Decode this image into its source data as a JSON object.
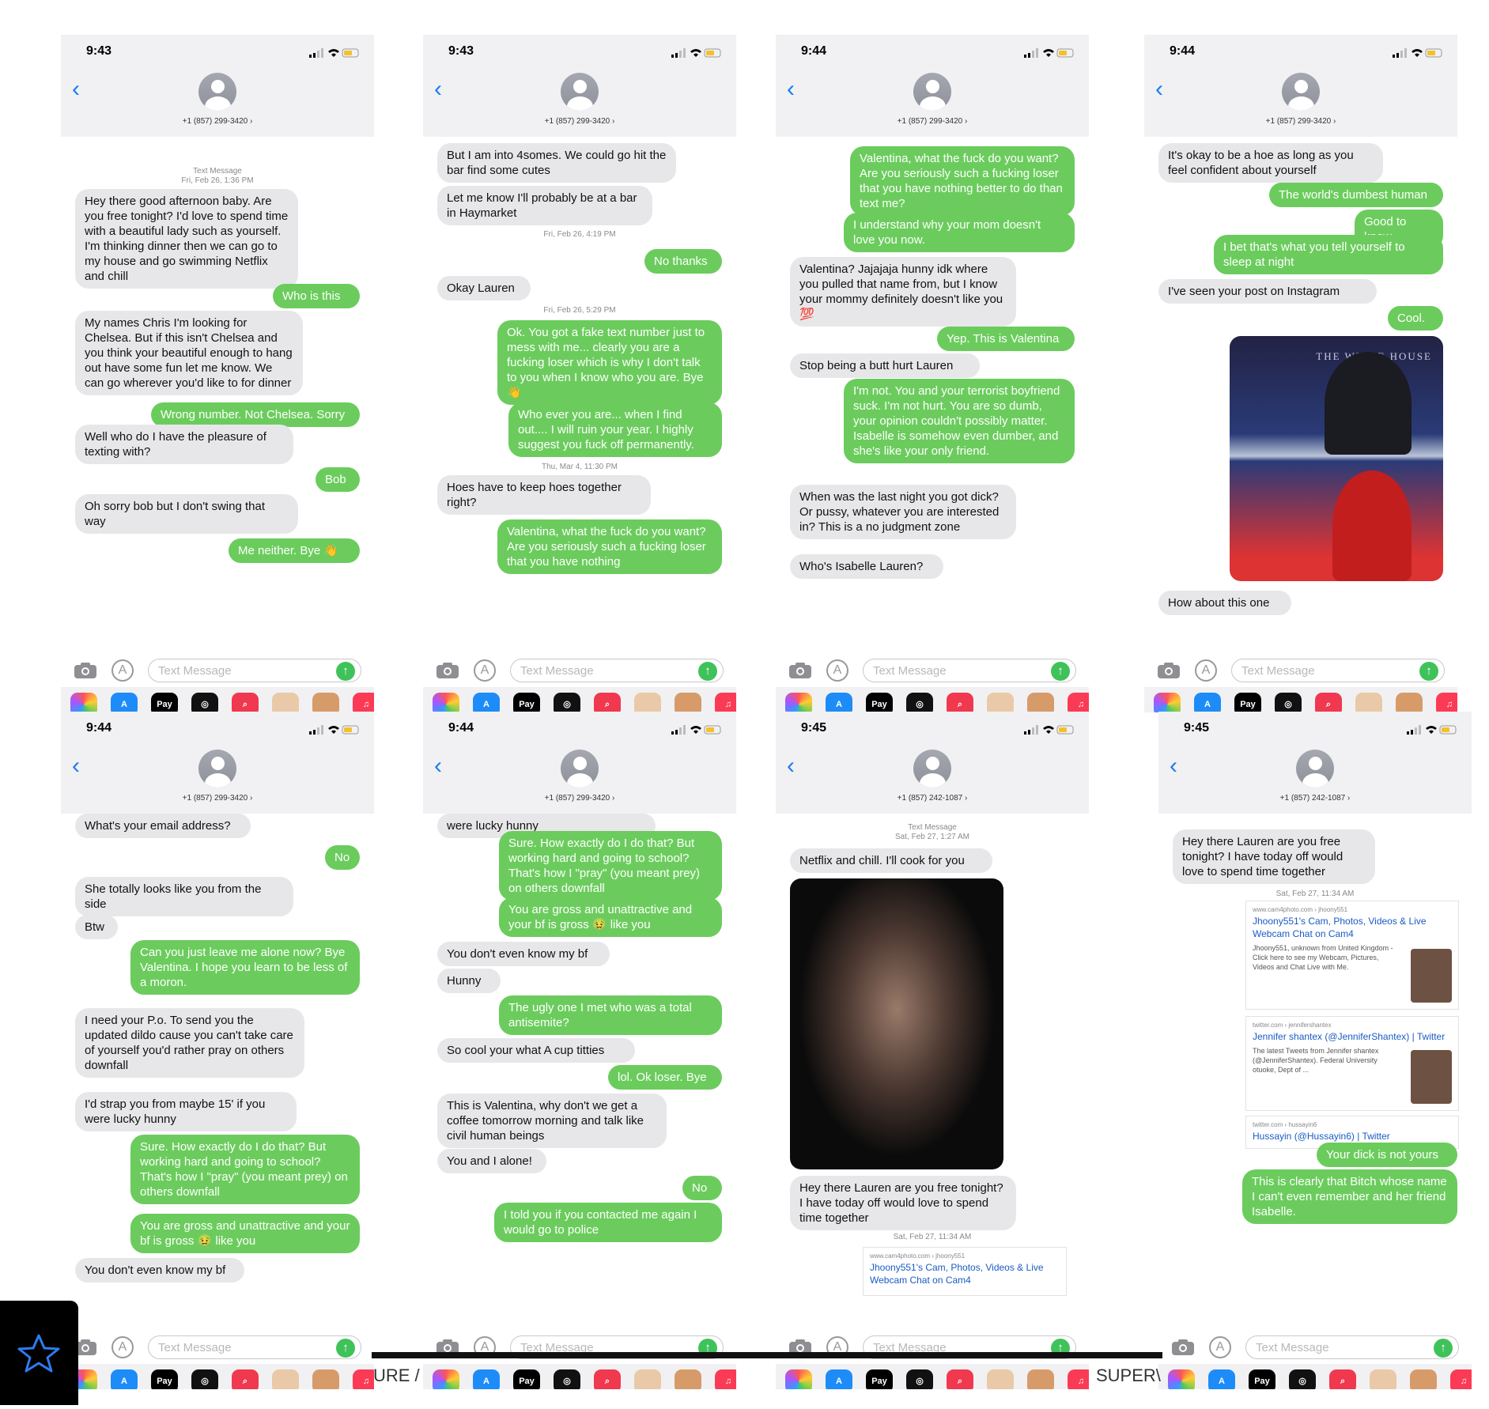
{
  "common": {
    "input_placeholder": "Text Message",
    "applepay_label": "Pay"
  },
  "panels": [
    {
      "time": "9:43",
      "phone": "+1 (857) 299-3420 ›",
      "items": [
        {
          "kind": "ts",
          "text": "Text Message"
        },
        {
          "kind": "ts",
          "text": "Fri, Feb 26, 1:36 PM"
        },
        {
          "kind": "in",
          "text": "Hey there good afternoon baby. Are you free tonight? I'd love to spend time with a beautiful lady such as yourself. I'm thinking dinner then we can go to my house and go swimming Netflix and chill"
        },
        {
          "kind": "out",
          "text": "Who is this"
        },
        {
          "kind": "in",
          "text": "My names Chris I'm looking for Chelsea. But if this isn't Chelsea and you think your beautiful enough to hang out have some fun let me know. We can go wherever you'd like to for dinner"
        },
        {
          "kind": "out",
          "text": "Wrong number. Not Chelsea. Sorry"
        },
        {
          "kind": "in",
          "text": "Well who do I have the pleasure of texting with?"
        },
        {
          "kind": "out",
          "text": "Bob"
        },
        {
          "kind": "in",
          "text": "Oh sorry bob but I don't swing that way"
        },
        {
          "kind": "out",
          "text": "Me neither. Bye 👋"
        }
      ]
    },
    {
      "time": "9:43",
      "phone": "+1 (857) 299-3420 ›",
      "items": [
        {
          "kind": "in",
          "text": "But I am into 4somes. We could go hit the bar find some cutes"
        },
        {
          "kind": "in",
          "text": "Let me know I'll probably be at  a bar in Haymarket"
        },
        {
          "kind": "ts",
          "text": "Fri, Feb 26, 4:19 PM"
        },
        {
          "kind": "out",
          "text": "No thanks"
        },
        {
          "kind": "in",
          "text": "Okay Lauren"
        },
        {
          "kind": "ts",
          "text": "Fri, Feb 26, 5:29 PM"
        },
        {
          "kind": "out",
          "text": "Ok. You got a fake text number just to mess with me... clearly you are a fucking loser which is why I don't talk to you when I know who you are. Bye 👋"
        },
        {
          "kind": "out",
          "text": "Who ever you are... when I find out.... I will ruin your year. I highly suggest you fuck off permanently."
        },
        {
          "kind": "ts",
          "text": "Thu, Mar 4, 11:30 PM"
        },
        {
          "kind": "in",
          "text": "Hoes have to keep hoes together right?"
        },
        {
          "kind": "out",
          "text": "Valentina, what the fuck do you want? Are you seriously such a fucking loser that you have nothing"
        }
      ]
    },
    {
      "time": "9:44",
      "phone": "+1 (857) 299-3420 ›",
      "items": [
        {
          "kind": "out",
          "text": "Valentina, what the fuck do you want? Are you seriously such a fucking loser that you have nothing better to do than text me?"
        },
        {
          "kind": "out",
          "text": "I understand why your mom doesn't love you now."
        },
        {
          "kind": "in",
          "text": "Valentina? Jajajaja hunny idk where you pulled that name from, but I know your mommy definitely doesn't like you 💯"
        },
        {
          "kind": "out",
          "text": "Yep. This is Valentina"
        },
        {
          "kind": "in",
          "text": "Stop being a butt hurt Lauren"
        },
        {
          "kind": "out",
          "text": "I'm not. You and your terrorist boyfriend suck. I'm not hurt. You are so dumb, your opinion couldn't possibly matter. Isabelle is somehow even dumber, and she's like your only friend."
        },
        {
          "kind": "in",
          "text": "When was the last night you got dick? Or pussy, whatever you are interested in? This is a no judgment zone"
        },
        {
          "kind": "in",
          "text": "Who's Isabelle Lauren?"
        }
      ]
    },
    {
      "time": "9:44",
      "phone": "+1 (857) 299-3420 ›",
      "items": [
        {
          "kind": "in",
          "text": "It's okay to be a hoe as long as you feel confident about yourself"
        },
        {
          "kind": "out",
          "text": "The world's dumbest human"
        },
        {
          "kind": "out",
          "text": "Good to know"
        },
        {
          "kind": "out",
          "text": "I bet that's what you tell yourself to sleep at night"
        },
        {
          "kind": "in",
          "text": "I've seen your post on Instagram"
        },
        {
          "kind": "out",
          "text": "Cool."
        },
        {
          "kind": "img",
          "text": "THE WHITE HOUSE"
        },
        {
          "kind": "in",
          "text": "How about this one"
        }
      ]
    },
    {
      "time": "9:44",
      "phone": "+1 (857) 299-3420 ›",
      "items": [
        {
          "kind": "in",
          "text": "What's your email address?"
        },
        {
          "kind": "out",
          "text": "No"
        },
        {
          "kind": "in",
          "text": "She totally looks like you from the side"
        },
        {
          "kind": "in",
          "text": "Btw"
        },
        {
          "kind": "out",
          "text": "Can you just leave me alone now? Bye Valentina. I hope you learn to be less of a moron."
        },
        {
          "kind": "in",
          "text": "I need your P.o. To send you the updated dildo cause you can't take care of yourself you'd rather pray on others downfall"
        },
        {
          "kind": "in",
          "text": "I'd strap you from maybe 15' if you were lucky hunny"
        },
        {
          "kind": "out",
          "text": "Sure. How exactly do I do that? But working hard and going to school? That's how I \"pray\" (you meant prey) on others downfall"
        },
        {
          "kind": "out",
          "text": "You are gross and unattractive and your bf is gross 🤢 like you"
        },
        {
          "kind": "in",
          "text": "You don't even know my bf"
        }
      ]
    },
    {
      "time": "9:44",
      "phone": "+1 (857) 299-3420 ›",
      "items": [
        {
          "kind": "in",
          "text": "were lucky hunny"
        },
        {
          "kind": "out",
          "text": "Sure. How exactly do I do that? But working hard and going to school? That's how I \"pray\" (you meant prey) on others downfall"
        },
        {
          "kind": "out",
          "text": "You are gross and unattractive and your bf is gross 🤢 like you"
        },
        {
          "kind": "in",
          "text": "You don't even know my bf"
        },
        {
          "kind": "in",
          "text": "Hunny"
        },
        {
          "kind": "out",
          "text": "The ugly one I met who was a total antisemite?"
        },
        {
          "kind": "in",
          "text": "So cool your what A cup titties"
        },
        {
          "kind": "out",
          "text": "lol. Ok loser. Bye"
        },
        {
          "kind": "in",
          "text": "This is Valentina, why don't we get a coffee tomorrow morning and talk like civil human beings"
        },
        {
          "kind": "in",
          "text": "You and I alone!"
        },
        {
          "kind": "out",
          "text": "No"
        },
        {
          "kind": "out",
          "text": "I told you if you contacted me again I would go to police"
        }
      ]
    },
    {
      "time": "9:45",
      "phone": "+1 (857) 242-1087 ›",
      "items": [
        {
          "kind": "ts",
          "text": "Text Message"
        },
        {
          "kind": "ts",
          "text": "Sat, Feb 27, 1:27 AM"
        },
        {
          "kind": "in",
          "text": "Netflix and chill. I'll cook for you"
        },
        {
          "kind": "img",
          "text": ""
        },
        {
          "kind": "in",
          "text": "Hey there Lauren are you free tonight? I have today off would love to spend time together"
        },
        {
          "kind": "ts",
          "text": "Sat, Feb 27, 11:34 AM"
        },
        {
          "kind": "card",
          "src": "www.cam4photo.com › jhoony551",
          "text": "Jhoony551's Cam, Photos, Videos & Live Webcam Chat on Cam4"
        }
      ]
    },
    {
      "time": "9:45",
      "phone": "+1 (857) 242-1087 ›",
      "items": [
        {
          "kind": "in",
          "text": "Hey there Lauren are you free tonight? I have today off would love to spend time together"
        },
        {
          "kind": "ts",
          "text": "Sat, Feb 27, 11:34 AM"
        },
        {
          "kind": "card",
          "src": "www.cam4photo.com › jhoony551",
          "text": "Jhoony551's Cam, Photos, Videos & Live Webcam Chat on Cam4",
          "desc": "Jhoony551, unknown from United Kingdom - Click here to see my Webcam, Pictures, Videos and Chat Live with Me."
        },
        {
          "kind": "card",
          "src": "twitter.com › jennifershantex",
          "text": "Jennifer shantex (@JenniferShantex) | Twitter",
          "desc": "The latest Tweets from Jennifer shantex (@JenniferShantex). Federal University otuoke, Dept of ..."
        },
        {
          "kind": "card",
          "src": "twitter.com › hussayin6",
          "text": "Hussayin (@Hussayin6) | Twitter"
        },
        {
          "kind": "out",
          "text": "Your dick is not yours"
        },
        {
          "kind": "out",
          "text": "This is clearly that Bitch whose name I can't even remember and her friend Isabelle."
        }
      ]
    }
  ],
  "footer": {
    "left_text": "URE /",
    "right_text": "SUPER\\"
  },
  "colors": {
    "incoming": "#e7e7ea",
    "outgoing": "#6bcc5d",
    "link": "#1a7cf5"
  }
}
